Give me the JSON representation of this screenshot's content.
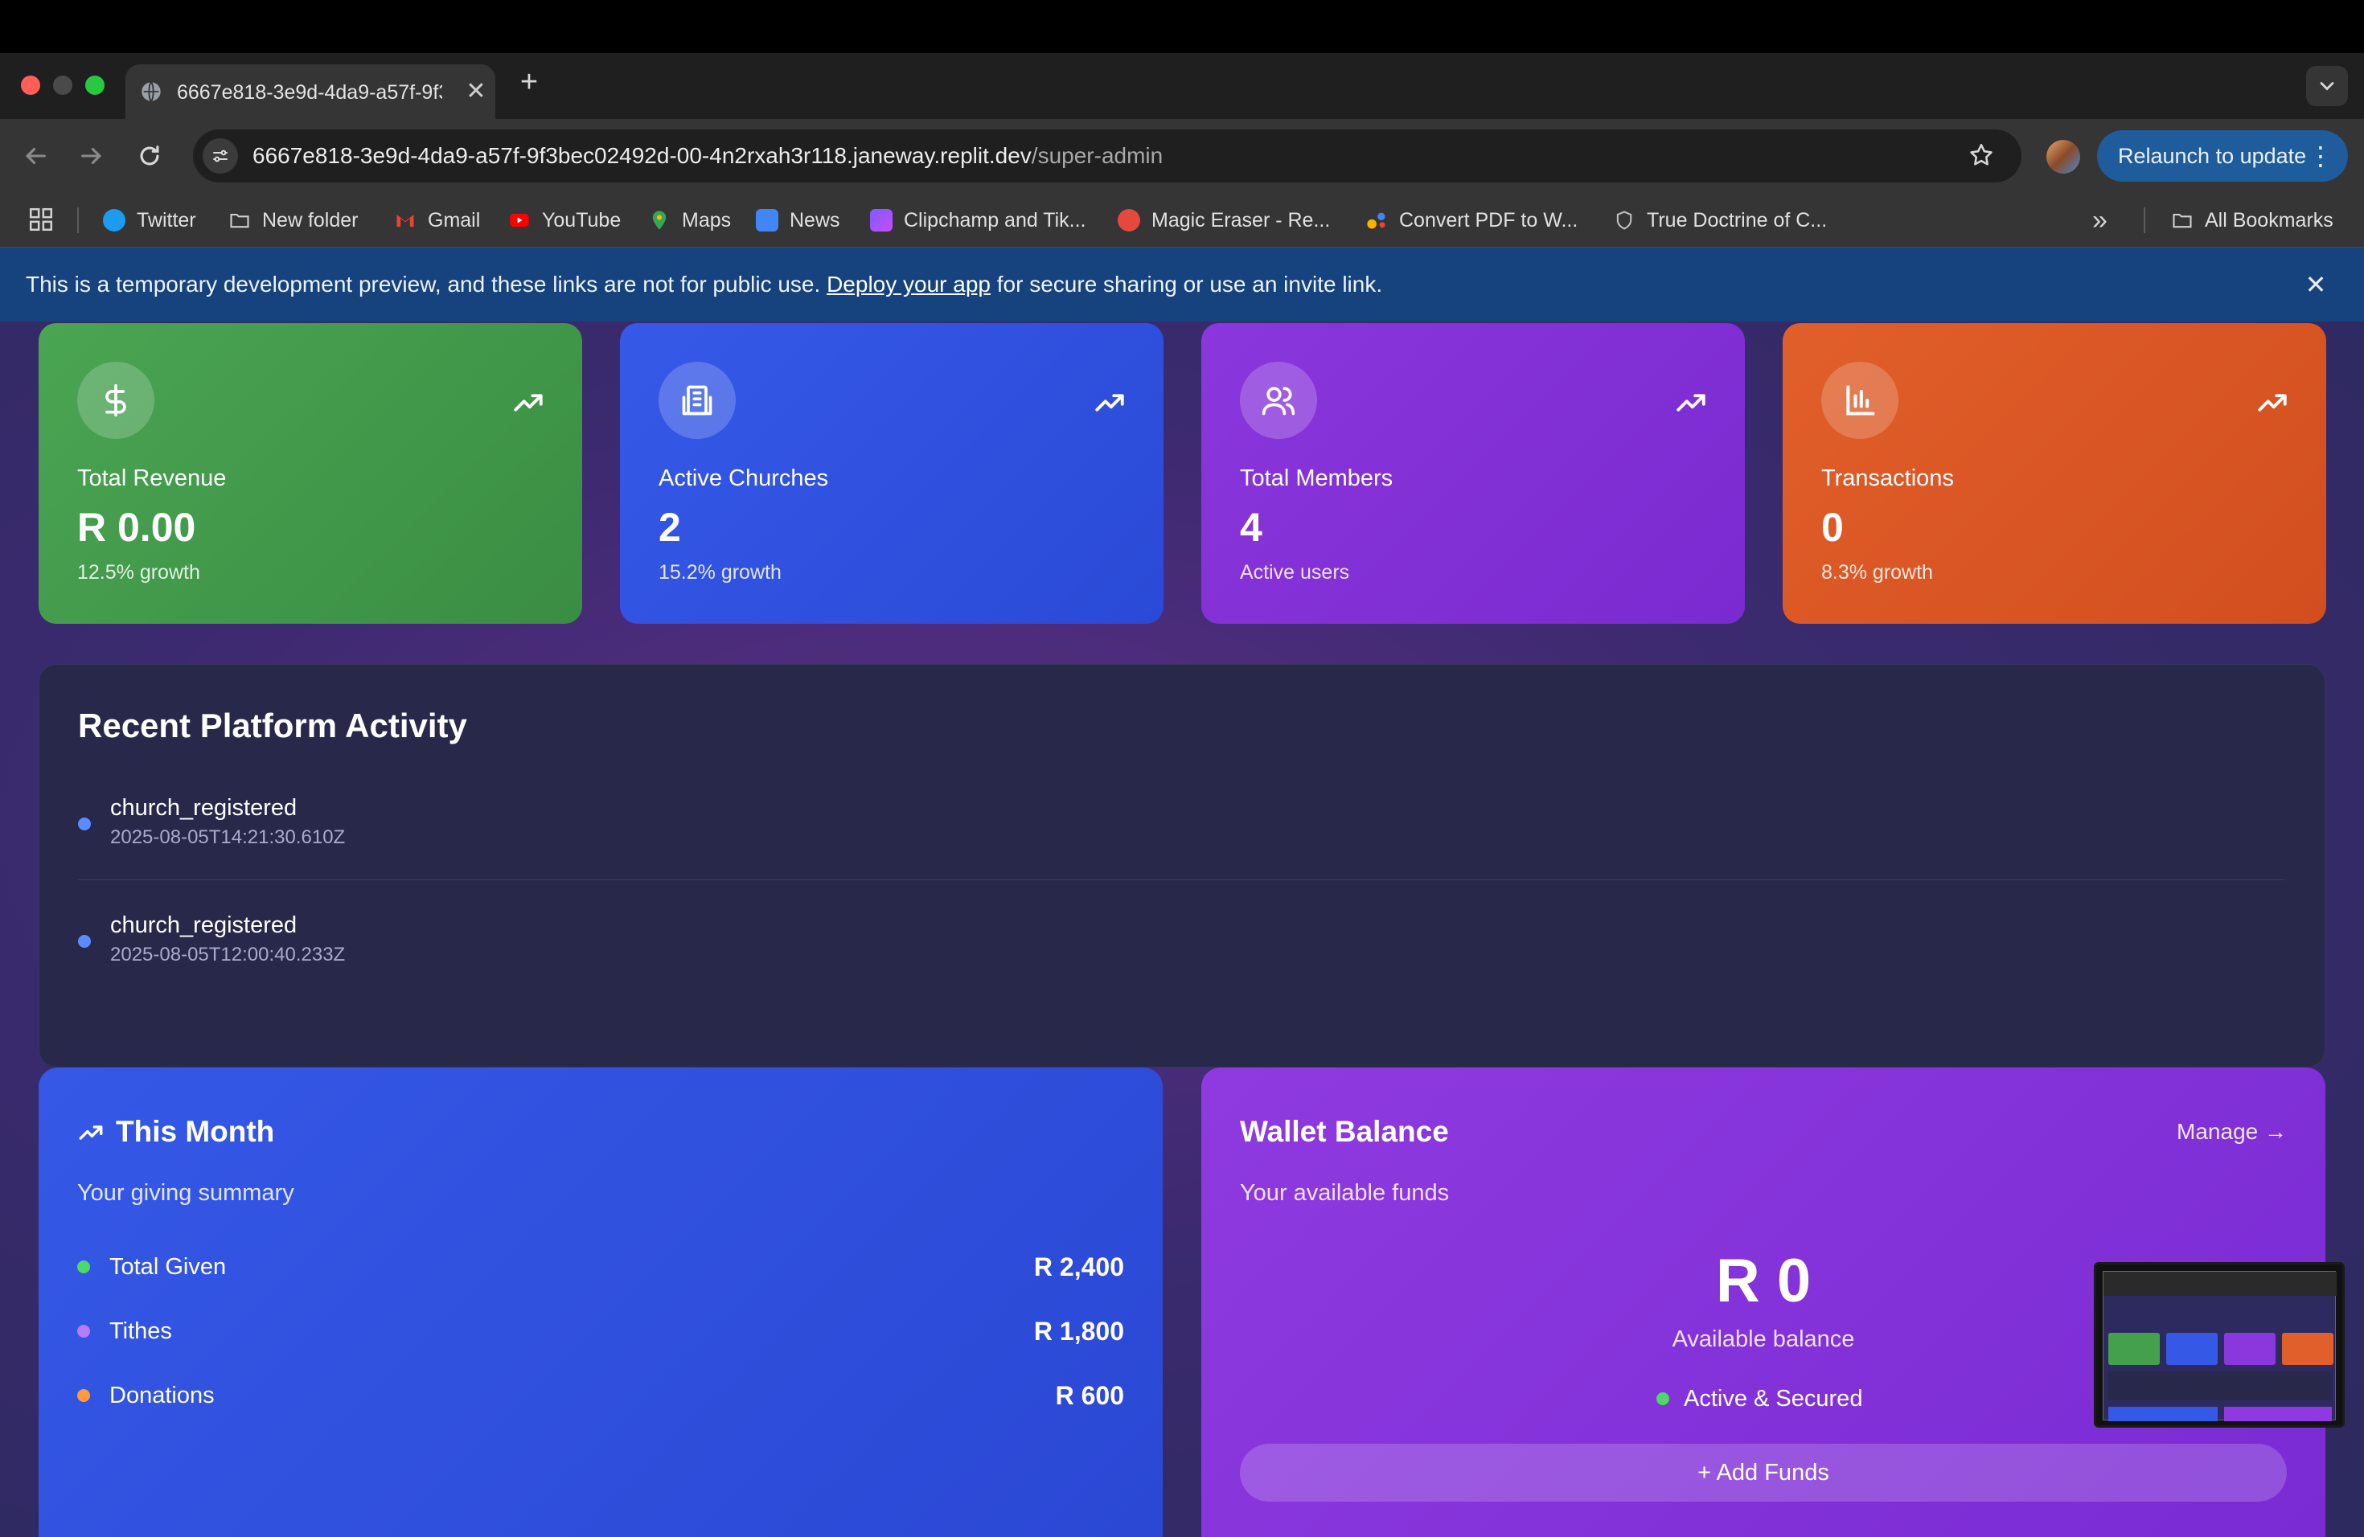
{
  "browser": {
    "tab_title": "6667e818-3e9d-4da9-a57f-9f3bec02492d-00-4n2rxah3r118.janeway.replit.dev",
    "tab_close": "✕",
    "new_tab": "+",
    "url_host": "6667e818-3e9d-4da9-a57f-9f3bec02492d-00-4n2rxah3r118.janeway.replit.dev",
    "url_path": "/super-admin",
    "relaunch_label": "Relaunch to update",
    "bookmarks": [
      {
        "label": "Twitter",
        "icon": "twitter-icon",
        "color": "#1d9bf0"
      },
      {
        "label": "New folder",
        "icon": "folder-icon",
        "color": "#d0d0d0"
      },
      {
        "label": "Gmail",
        "icon": "gmail-icon",
        "color": "#ea4335"
      },
      {
        "label": "YouTube",
        "icon": "youtube-icon",
        "color": "#ff0000"
      },
      {
        "label": "Maps",
        "icon": "maps-icon",
        "color": "#34a853"
      },
      {
        "label": "News",
        "icon": "news-icon",
        "color": "#4285f4"
      },
      {
        "label": "Clipchamp and Tik...",
        "icon": "clipchamp-icon",
        "color": "#7b5cff"
      },
      {
        "label": "Magic Eraser - Re...",
        "icon": "magic-eraser-icon",
        "color": "#e5483e"
      },
      {
        "label": "Convert PDF to W...",
        "icon": "convert-pdf-icon",
        "color": "#f4b400"
      },
      {
        "label": "True Doctrine of C...",
        "icon": "shield-icon",
        "color": "#bdbdbd"
      }
    ],
    "all_bookmarks": "All Bookmarks"
  },
  "banner": {
    "text_before": "This is a temporary development preview, and these links are not for public use. ",
    "link": "Deploy your app",
    "text_after": " for secure sharing or use an invite link.",
    "close": "✕"
  },
  "stats": [
    {
      "label": "Total Revenue",
      "value": "R 0.00",
      "sub": "12.5% growth",
      "icon": "dollar-icon",
      "color": "#45a04e"
    },
    {
      "label": "Active Churches",
      "value": "2",
      "sub": "15.2% growth",
      "icon": "building-icon",
      "color": "#3558e6"
    },
    {
      "label": "Total Members",
      "value": "4",
      "sub": "Active users",
      "icon": "users-icon",
      "color": "#8a37dd"
    },
    {
      "label": "Transactions",
      "value": "0",
      "sub": "8.3% growth",
      "icon": "bar-chart-icon",
      "color": "#e15f2a"
    }
  ],
  "activity": {
    "title": "Recent Platform Activity",
    "items": [
      {
        "name": "church_registered",
        "time": "2025-08-05T14:21:30.610Z"
      },
      {
        "name": "church_registered",
        "time": "2025-08-05T12:00:40.233Z"
      }
    ]
  },
  "month": {
    "title": "This Month",
    "subtitle": "Your giving summary",
    "rows": [
      {
        "label": "Total Given",
        "value": "R 2,400",
        "dot_color": "#4cd964"
      },
      {
        "label": "Tithes",
        "value": "R 1,800",
        "dot_color": "#b57cff"
      },
      {
        "label": "Donations",
        "value": "R 600",
        "dot_color": "#ff9a3c"
      }
    ]
  },
  "wallet": {
    "title": "Wallet Balance",
    "manage": "Manage →",
    "subtitle": "Your available funds",
    "amount": "R 0",
    "available_label": "Available balance",
    "status": "Active & Secured",
    "add_funds": "+ Add Funds"
  }
}
